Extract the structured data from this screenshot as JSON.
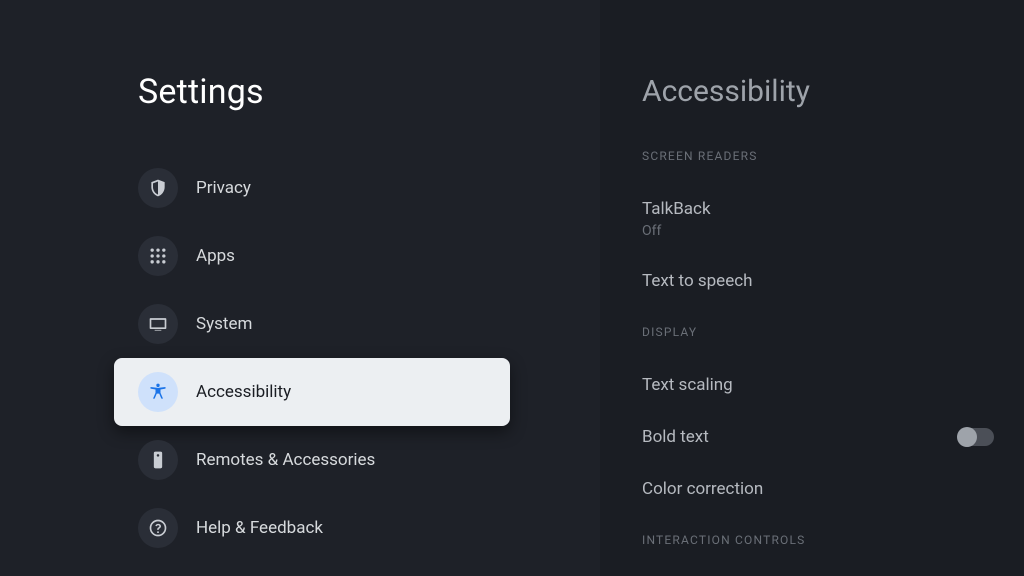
{
  "left": {
    "title": "Settings",
    "items": [
      {
        "id": "privacy",
        "label": "Privacy",
        "icon": "shield-icon"
      },
      {
        "id": "apps",
        "label": "Apps",
        "icon": "apps-icon"
      },
      {
        "id": "system",
        "label": "System",
        "icon": "tv-icon"
      },
      {
        "id": "accessibility",
        "label": "Accessibility",
        "icon": "accessibility-icon",
        "selected": true
      },
      {
        "id": "remotes",
        "label": "Remotes & Accessories",
        "icon": "remote-icon"
      },
      {
        "id": "help",
        "label": "Help & Feedback",
        "icon": "help-icon"
      }
    ]
  },
  "right": {
    "title": "Accessibility",
    "sections": [
      {
        "header": "SCREEN READERS",
        "rows": [
          {
            "title": "TalkBack",
            "sub": "Off"
          },
          {
            "title": "Text to speech"
          }
        ]
      },
      {
        "header": "DISPLAY",
        "rows": [
          {
            "title": "Text scaling"
          },
          {
            "title": "Bold text",
            "toggle": false
          },
          {
            "title": "Color correction"
          }
        ]
      },
      {
        "header": "INTERACTION CONTROLS",
        "rows": []
      }
    ]
  }
}
